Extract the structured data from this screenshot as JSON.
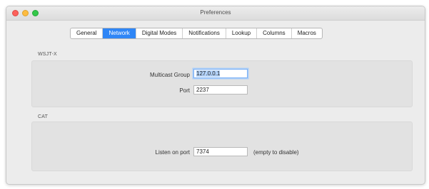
{
  "window": {
    "title": "Preferences"
  },
  "tabs": [
    {
      "label": "General",
      "active": false
    },
    {
      "label": "Network",
      "active": true
    },
    {
      "label": "Digital Modes",
      "active": false
    },
    {
      "label": "Notifications",
      "active": false
    },
    {
      "label": "Lookup",
      "active": false
    },
    {
      "label": "Columns",
      "active": false
    },
    {
      "label": "Macros",
      "active": false
    }
  ],
  "wsjtx": {
    "section_label": "WSJT-X",
    "multicast_label": "Multicast Group",
    "multicast_value": "127.0.0.1",
    "port_label": "Port",
    "port_value": "2237"
  },
  "cat": {
    "section_label": "CAT",
    "listen_label": "Listen on port",
    "listen_value": "7374",
    "listen_hint": "(empty to disable)"
  },
  "colors": {
    "accent": "#2f86f6",
    "close": "#fc605b",
    "minimize": "#fdbc40",
    "maximize": "#34c84a"
  }
}
